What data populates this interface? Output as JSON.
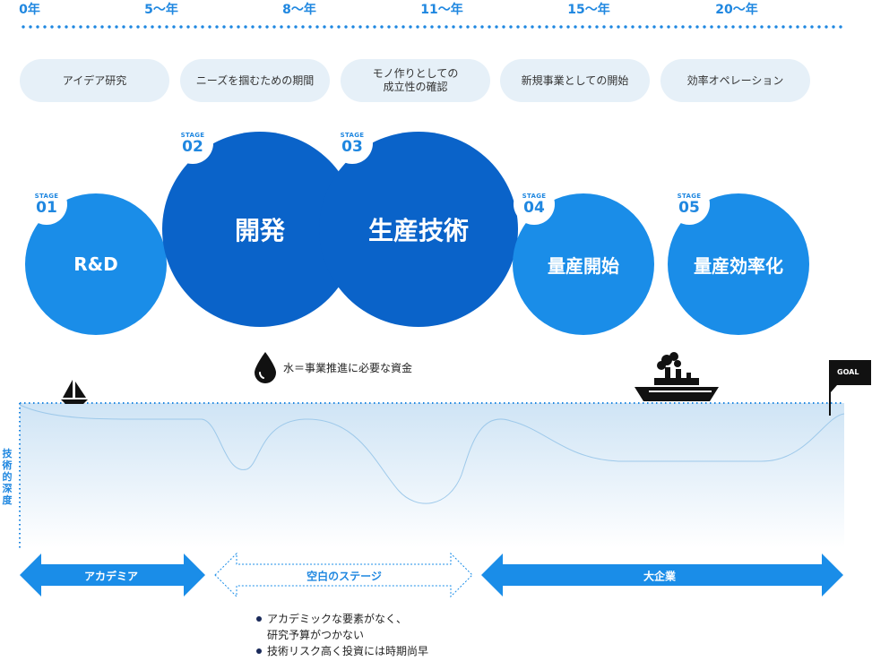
{
  "timeline": {
    "years": [
      "0年",
      "5〜年",
      "8〜年",
      "11〜年",
      "15〜年",
      "20〜年"
    ]
  },
  "phases": [
    {
      "text": "アイデア研究"
    },
    {
      "text": "ニーズを掴むための期間"
    },
    {
      "line1": "モノ作りとしての",
      "line2": "成立性の確認"
    },
    {
      "text": "新規事業としての開始"
    },
    {
      "text": "効率オペレーション"
    }
  ],
  "stages": [
    {
      "stage": "STAGE",
      "num": "01",
      "label": "R&D",
      "color": "#1a8de8"
    },
    {
      "stage": "STAGE",
      "num": "02",
      "label": "開発",
      "color": "#0a63c9"
    },
    {
      "stage": "STAGE",
      "num": "03",
      "label": "生産技術",
      "color": "#0a63c9"
    },
    {
      "stage": "STAGE",
      "num": "04",
      "label": "量産開始",
      "color": "#1a8de8"
    },
    {
      "stage": "STAGE",
      "num": "05",
      "label": "量産効率化",
      "color": "#1a8de8"
    }
  ],
  "legend": {
    "water": "水＝事業推進に必要な資金",
    "icon": "water-drop-icon"
  },
  "depth_label": "技術的深度",
  "goal": "GOAL",
  "icons": [
    "sailboat-icon",
    "ship-icon",
    "goal-flag-icon"
  ],
  "arrows": {
    "academia": "アカデミア",
    "gap": "空白のステージ",
    "enterprise": "大企業"
  },
  "notes": {
    "item1_line1": "アカデミックな要素がなく、",
    "item1_line2": "研究予算がつかない",
    "item2": "技術リスク高く投資には時期尚早"
  },
  "colors": {
    "accent": "#1f87e0",
    "dark_blue": "#0a63c9",
    "pill_bg": "#e6f0f8"
  }
}
